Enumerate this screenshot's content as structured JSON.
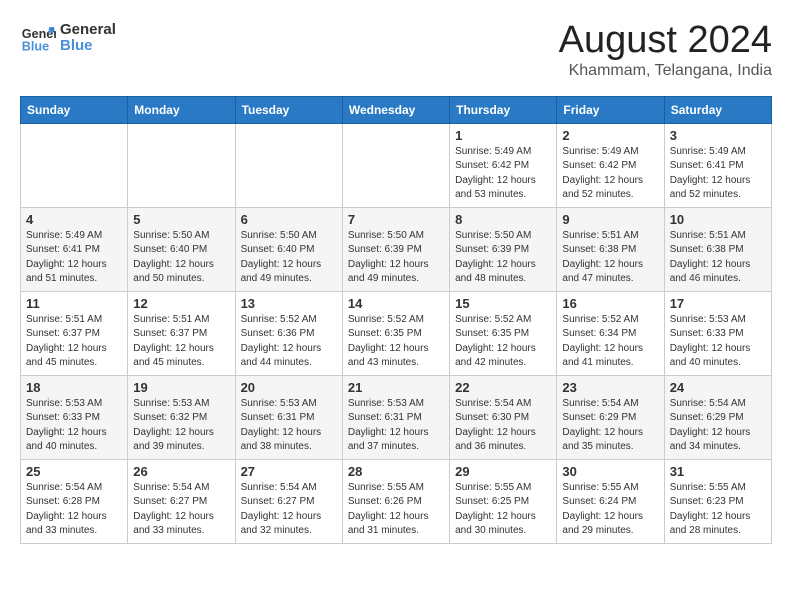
{
  "logo": {
    "line1": "General",
    "line2": "Blue"
  },
  "title": "August 2024",
  "subtitle": "Khammam, Telangana, India",
  "days_of_week": [
    "Sunday",
    "Monday",
    "Tuesday",
    "Wednesday",
    "Thursday",
    "Friday",
    "Saturday"
  ],
  "weeks": [
    [
      {
        "day": "",
        "content": ""
      },
      {
        "day": "",
        "content": ""
      },
      {
        "day": "",
        "content": ""
      },
      {
        "day": "",
        "content": ""
      },
      {
        "day": "1",
        "content": "Sunrise: 5:49 AM\nSunset: 6:42 PM\nDaylight: 12 hours\nand 53 minutes."
      },
      {
        "day": "2",
        "content": "Sunrise: 5:49 AM\nSunset: 6:42 PM\nDaylight: 12 hours\nand 52 minutes."
      },
      {
        "day": "3",
        "content": "Sunrise: 5:49 AM\nSunset: 6:41 PM\nDaylight: 12 hours\nand 52 minutes."
      }
    ],
    [
      {
        "day": "4",
        "content": "Sunrise: 5:49 AM\nSunset: 6:41 PM\nDaylight: 12 hours\nand 51 minutes."
      },
      {
        "day": "5",
        "content": "Sunrise: 5:50 AM\nSunset: 6:40 PM\nDaylight: 12 hours\nand 50 minutes."
      },
      {
        "day": "6",
        "content": "Sunrise: 5:50 AM\nSunset: 6:40 PM\nDaylight: 12 hours\nand 49 minutes."
      },
      {
        "day": "7",
        "content": "Sunrise: 5:50 AM\nSunset: 6:39 PM\nDaylight: 12 hours\nand 49 minutes."
      },
      {
        "day": "8",
        "content": "Sunrise: 5:50 AM\nSunset: 6:39 PM\nDaylight: 12 hours\nand 48 minutes."
      },
      {
        "day": "9",
        "content": "Sunrise: 5:51 AM\nSunset: 6:38 PM\nDaylight: 12 hours\nand 47 minutes."
      },
      {
        "day": "10",
        "content": "Sunrise: 5:51 AM\nSunset: 6:38 PM\nDaylight: 12 hours\nand 46 minutes."
      }
    ],
    [
      {
        "day": "11",
        "content": "Sunrise: 5:51 AM\nSunset: 6:37 PM\nDaylight: 12 hours\nand 45 minutes."
      },
      {
        "day": "12",
        "content": "Sunrise: 5:51 AM\nSunset: 6:37 PM\nDaylight: 12 hours\nand 45 minutes."
      },
      {
        "day": "13",
        "content": "Sunrise: 5:52 AM\nSunset: 6:36 PM\nDaylight: 12 hours\nand 44 minutes."
      },
      {
        "day": "14",
        "content": "Sunrise: 5:52 AM\nSunset: 6:35 PM\nDaylight: 12 hours\nand 43 minutes."
      },
      {
        "day": "15",
        "content": "Sunrise: 5:52 AM\nSunset: 6:35 PM\nDaylight: 12 hours\nand 42 minutes."
      },
      {
        "day": "16",
        "content": "Sunrise: 5:52 AM\nSunset: 6:34 PM\nDaylight: 12 hours\nand 41 minutes."
      },
      {
        "day": "17",
        "content": "Sunrise: 5:53 AM\nSunset: 6:33 PM\nDaylight: 12 hours\nand 40 minutes."
      }
    ],
    [
      {
        "day": "18",
        "content": "Sunrise: 5:53 AM\nSunset: 6:33 PM\nDaylight: 12 hours\nand 40 minutes."
      },
      {
        "day": "19",
        "content": "Sunrise: 5:53 AM\nSunset: 6:32 PM\nDaylight: 12 hours\nand 39 minutes."
      },
      {
        "day": "20",
        "content": "Sunrise: 5:53 AM\nSunset: 6:31 PM\nDaylight: 12 hours\nand 38 minutes."
      },
      {
        "day": "21",
        "content": "Sunrise: 5:53 AM\nSunset: 6:31 PM\nDaylight: 12 hours\nand 37 minutes."
      },
      {
        "day": "22",
        "content": "Sunrise: 5:54 AM\nSunset: 6:30 PM\nDaylight: 12 hours\nand 36 minutes."
      },
      {
        "day": "23",
        "content": "Sunrise: 5:54 AM\nSunset: 6:29 PM\nDaylight: 12 hours\nand 35 minutes."
      },
      {
        "day": "24",
        "content": "Sunrise: 5:54 AM\nSunset: 6:29 PM\nDaylight: 12 hours\nand 34 minutes."
      }
    ],
    [
      {
        "day": "25",
        "content": "Sunrise: 5:54 AM\nSunset: 6:28 PM\nDaylight: 12 hours\nand 33 minutes."
      },
      {
        "day": "26",
        "content": "Sunrise: 5:54 AM\nSunset: 6:27 PM\nDaylight: 12 hours\nand 33 minutes."
      },
      {
        "day": "27",
        "content": "Sunrise: 5:54 AM\nSunset: 6:27 PM\nDaylight: 12 hours\nand 32 minutes."
      },
      {
        "day": "28",
        "content": "Sunrise: 5:55 AM\nSunset: 6:26 PM\nDaylight: 12 hours\nand 31 minutes."
      },
      {
        "day": "29",
        "content": "Sunrise: 5:55 AM\nSunset: 6:25 PM\nDaylight: 12 hours\nand 30 minutes."
      },
      {
        "day": "30",
        "content": "Sunrise: 5:55 AM\nSunset: 6:24 PM\nDaylight: 12 hours\nand 29 minutes."
      },
      {
        "day": "31",
        "content": "Sunrise: 5:55 AM\nSunset: 6:23 PM\nDaylight: 12 hours\nand 28 minutes."
      }
    ]
  ]
}
